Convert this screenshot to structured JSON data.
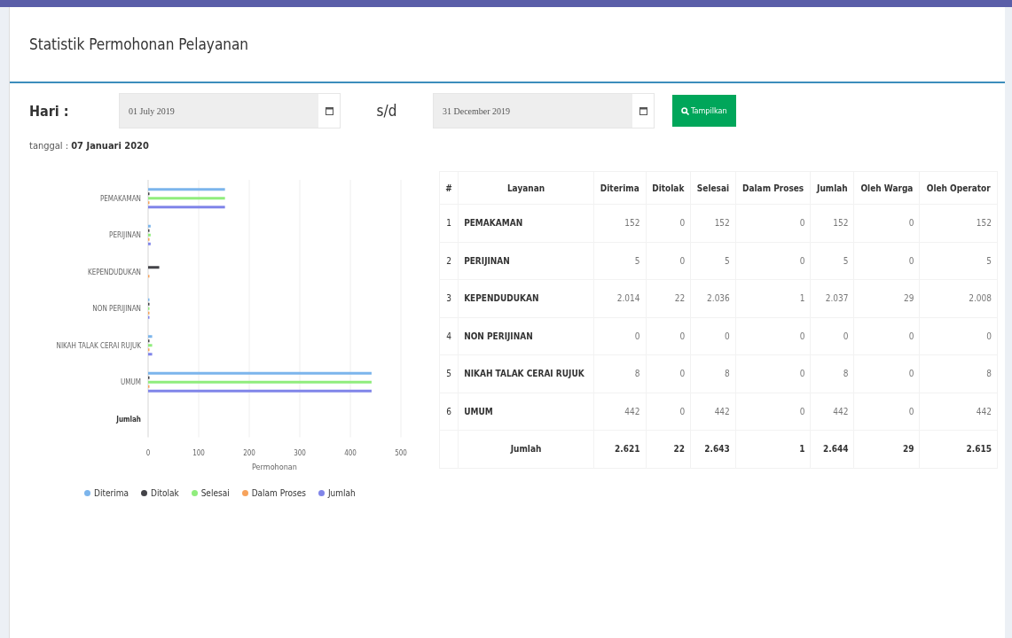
{
  "panel": {
    "title": "Statistik Permohonan Pelayanan"
  },
  "filter": {
    "label": "Hari :",
    "start_date": "01 July 2019",
    "separator": "s/d",
    "end_date": "31 December 2019",
    "button": "Tampilkan"
  },
  "date_line": {
    "label": "tanggal :",
    "value": "07 Januari 2020"
  },
  "chart": {
    "chart_data": {
      "type": "bar",
      "orientation": "horizontal",
      "xlabel": "Permohonan",
      "categories": [
        "PEMAKAMAN",
        "PERIJINAN",
        "KEPENDUDUKAN",
        "NON PERIJINAN",
        "NIKAH TALAK CERAI RUJUK",
        "UMUM",
        "Jumlah"
      ],
      "xlim": [
        0,
        500
      ],
      "grid": true,
      "legend": true,
      "xticks": [
        0,
        100,
        200,
        300,
        400,
        500
      ],
      "series": [
        {
          "name": "Diterima",
          "color": "#7cb5ec",
          "values": [
            152,
            5,
            null,
            0,
            8,
            442,
            null
          ]
        },
        {
          "name": "Ditolak",
          "color": "#434348",
          "values": [
            0,
            0,
            22,
            0,
            0,
            0,
            null
          ]
        },
        {
          "name": "Selesai",
          "color": "#90ed7d",
          "values": [
            152,
            5,
            null,
            0,
            8,
            442,
            null
          ]
        },
        {
          "name": "Dalam Proses",
          "color": "#f7a35c",
          "values": [
            0,
            0,
            1,
            0,
            0,
            0,
            null
          ]
        },
        {
          "name": "Jumlah",
          "color": "#8085e9",
          "values": [
            152,
            5,
            null,
            0,
            8,
            442,
            null
          ]
        }
      ]
    }
  },
  "table": {
    "columns": [
      "#",
      "Layanan",
      "Diterima",
      "Ditolak",
      "Selesai",
      "Dalam Proses",
      "Jumlah",
      "Oleh Warga",
      "Oleh Operator"
    ],
    "rows": [
      [
        "1",
        "PEMAKAMAN",
        "152",
        "0",
        "152",
        "0",
        "152",
        "0",
        "152"
      ],
      [
        "2",
        "PERIJINAN",
        "5",
        "0",
        "5",
        "0",
        "5",
        "0",
        "5"
      ],
      [
        "3",
        "KEPENDUDUKAN",
        "2.014",
        "22",
        "2.036",
        "1",
        "2.037",
        "29",
        "2.008"
      ],
      [
        "4",
        "NON PERIJINAN",
        "0",
        "0",
        "0",
        "0",
        "0",
        "0",
        "0"
      ],
      [
        "5",
        "NIKAH TALAK CERAI RUJUK",
        "8",
        "0",
        "8",
        "0",
        "8",
        "0",
        "8"
      ],
      [
        "6",
        "UMUM",
        "442",
        "0",
        "442",
        "0",
        "442",
        "0",
        "442"
      ]
    ],
    "total": [
      "Jumlah",
      "2.621",
      "22",
      "2.643",
      "1",
      "2.644",
      "29",
      "2.615"
    ]
  }
}
